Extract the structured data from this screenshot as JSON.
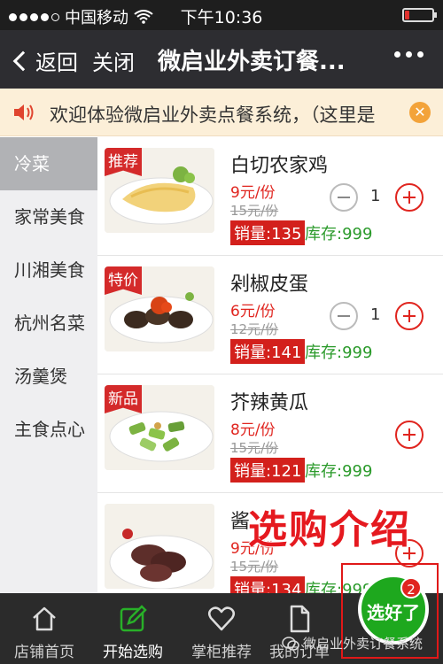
{
  "status_bar": {
    "carrier": "中国移动",
    "time": "下午10:36",
    "battery_level": 0.15,
    "battery_color": "#e0322f"
  },
  "nav": {
    "back_label": "返回",
    "close_label": "关闭",
    "title": "微启业外卖订餐..."
  },
  "notice": {
    "text": "欢迎体验微启业外卖点餐系统，（这里是"
  },
  "categories": [
    {
      "label": "冷菜",
      "active": true
    },
    {
      "label": "家常美食"
    },
    {
      "label": "川湘美食"
    },
    {
      "label": "杭州名菜"
    },
    {
      "label": "汤羹煲"
    },
    {
      "label": "主食点心"
    }
  ],
  "dishes": [
    {
      "tag": "推荐",
      "name": "白切农家鸡",
      "price": "9元/份",
      "original": "15元/份",
      "sales": "销量:135",
      "stock": "库存:999",
      "qty": "1"
    },
    {
      "tag": "特价",
      "name": "剁椒皮蛋",
      "price": "6元/份",
      "original": "12元/份",
      "sales": "销量:141",
      "stock": "库存:999",
      "qty": "1"
    },
    {
      "tag": "新品",
      "name": "芥辣黄瓜",
      "price": "8元/份",
      "original": "15元/份",
      "sales": "销量:121",
      "stock": "库存:999"
    },
    {
      "name": "酱",
      "price": "9元/份",
      "original": "15元/份",
      "sales": "销量:134",
      "stock": "库存:999"
    }
  ],
  "overlay_title": "选购介绍",
  "tabs": [
    {
      "label": "店铺首页",
      "icon": "home-icon"
    },
    {
      "label": "开始选购",
      "icon": "edit-icon",
      "active": true
    },
    {
      "label": "掌柜推荐",
      "icon": "heart-icon"
    },
    {
      "label": "我的订单",
      "icon": "document-icon"
    }
  ],
  "done_button": {
    "label": "选好了",
    "badge": "2"
  },
  "watermark": "微启业外卖订餐系统",
  "colors": {
    "accent_red": "#e0251f",
    "accent_green": "#1ea81e",
    "nav_bg": "#2d2d31"
  }
}
